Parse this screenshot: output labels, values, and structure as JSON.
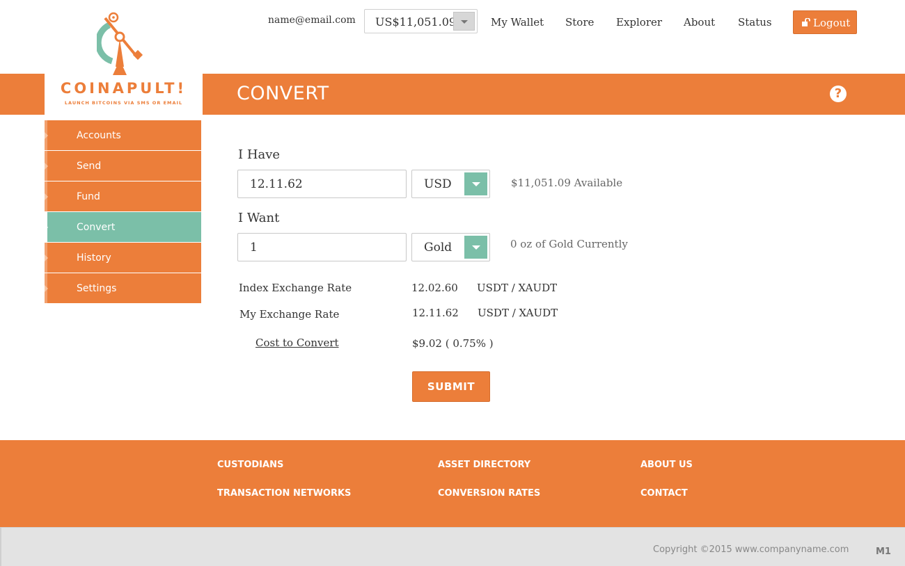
{
  "header": {
    "email": "name@email.com",
    "balance": "US$11,051.09",
    "nav": [
      "My Wallet",
      "Store",
      "Explorer",
      "About",
      "Status"
    ],
    "logout": "Logout"
  },
  "logo": {
    "name": "COINAPULT!",
    "tagline": "LAUNCH BITCOINS VIA SMS OR EMAIL"
  },
  "page": {
    "title": "CONVERT"
  },
  "sidebar": {
    "items": [
      {
        "label": "Accounts"
      },
      {
        "label": "Send"
      },
      {
        "label": "Fund"
      },
      {
        "label": "Convert",
        "active": true
      },
      {
        "label": "History"
      },
      {
        "label": "Settings"
      }
    ]
  },
  "form": {
    "have_label": "I Have",
    "have_value": "12.11.62",
    "have_currency": "USD",
    "have_note": "$11,051.09 Available",
    "want_label": "I Want",
    "want_value": "1",
    "want_currency": "Gold",
    "want_note": "0 oz of Gold Currently",
    "index_rate_label": "Index Exchange Rate",
    "index_rate_value": "12.02.60",
    "index_rate_unit": "USDT / XAUDT",
    "my_rate_label": "My Exchange Rate",
    "my_rate_value": "12.11.62",
    "my_rate_unit": "USDT / XAUDT",
    "cost_label": "Cost to Convert",
    "cost_value": "$9.02 ( 0.75% )",
    "submit": "SUBMIT"
  },
  "footer": {
    "col1": [
      "CUSTODIANS",
      "TRANSACTION NETWORKS"
    ],
    "col2": [
      "ASSET DIRECTORY",
      "CONVERSION RATES"
    ],
    "col3": [
      "ABOUT US",
      "CONTACT"
    ],
    "copyright": "Copyright ©2015 www.companyname.com",
    "version": "M1"
  },
  "colors": {
    "accent": "#ec7e3a",
    "teal": "#7bbfa8"
  }
}
